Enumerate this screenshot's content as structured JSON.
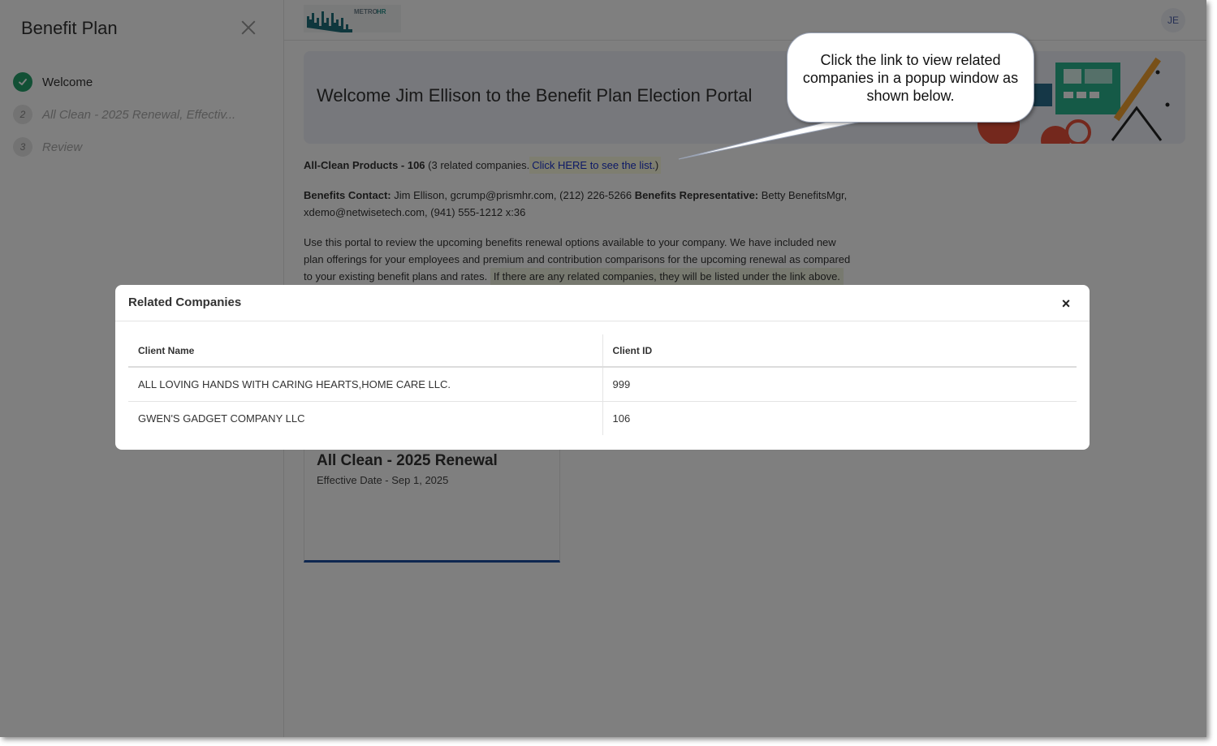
{
  "sidebar": {
    "title": "Benefit Plan",
    "steps": [
      {
        "num": "",
        "label": "Welcome"
      },
      {
        "num": "2",
        "label": "All Clean - 2025 Renewal, Effectiv..."
      },
      {
        "num": "3",
        "label": "Review"
      }
    ]
  },
  "header": {
    "logo_text": "METROHR",
    "avatar": "JE"
  },
  "banner": {
    "title": "Welcome Jim Ellison to the Benefit Plan Election Portal"
  },
  "company": {
    "name": "All-Clean Products - 106",
    "related_count_text": "(3 related companies.",
    "link_text": "Click HERE to see the list.",
    "close_paren": ")"
  },
  "contact": {
    "contact_label": "Benefits Contact:",
    "contact_value": "Jim Ellison, gcrump@prismhr.com, (212) 226-5266",
    "rep_label": "Benefits Representative:",
    "rep_value": "Betty BenefitsMgr,",
    "rep_value_2": "xdemo@netwisetech.com, (941) 555-1212 x:36"
  },
  "intro": {
    "line1": "Use this portal to review the upcoming benefits renewal options available to your company. We have included new",
    "line2": "plan offerings for your employees and premium and contribution comparisons for the upcoming renewal as compared",
    "line3": "to your existing benefit plans and rates.",
    "note": "If there are any related companies, they will be listed under the link above."
  },
  "plan_card": {
    "title": "All Clean - 2025 Renewal",
    "date": "Effective Date - Sep 1, 2025"
  },
  "callout": {
    "text": "Click the link to view related companies in a popup window as shown below."
  },
  "modal": {
    "title": "Related Companies",
    "close": "×",
    "columns": [
      "Client Name",
      "Client ID"
    ],
    "rows": [
      {
        "name": "ALL LOVING HANDS WITH CARING HEARTS,HOME CARE LLC.",
        "id": "999"
      },
      {
        "name": "GWEN'S GADGET COMPANY LLC",
        "id": "106"
      }
    ]
  },
  "colors": {
    "accent_green": "#24a06b",
    "link_blue": "#1a33cc",
    "card_underline": "#1c4fa0",
    "logo_teal": "#1f6f7a"
  }
}
